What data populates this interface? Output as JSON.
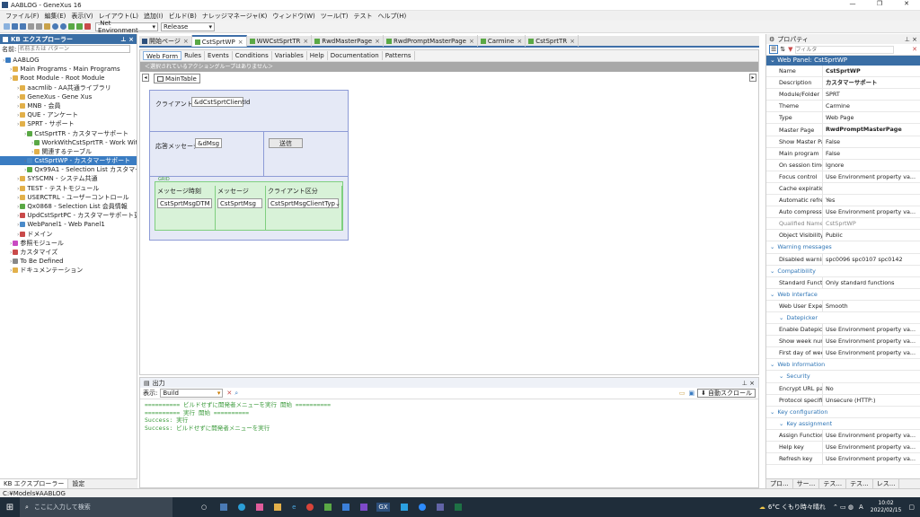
{
  "window": {
    "title": "AABLOG - GeneXus 16"
  },
  "menu": [
    "ファイル(F)",
    "編集(E)",
    "表示(V)",
    "レイアウト(L)",
    "追加(I)",
    "ビルド(B)",
    "ナレッジマネージャ(K)",
    "ウィンドウ(W)",
    "ツール(T)",
    "テスト",
    "ヘルプ(H)"
  ],
  "toolbar": {
    "environment": ".Net Environment",
    "configuration": "Release"
  },
  "explorer": {
    "title": "KB エクスプローラー",
    "filter_label": "名前:",
    "filter_placeholder": "名前または パターン",
    "items": [
      {
        "label": "AABLOG",
        "indent": 0,
        "color": "#3a7cc2"
      },
      {
        "label": "Main Programs - Main Programs",
        "indent": 1,
        "color": "#e2b04a"
      },
      {
        "label": "Root Module - Root Module",
        "indent": 1,
        "color": "#e2b04a"
      },
      {
        "label": "aacmlib - AA共通ライブラリ",
        "indent": 2,
        "color": "#e2b04a"
      },
      {
        "label": "GeneXus - Gene Xus",
        "indent": 2,
        "color": "#e2b04a"
      },
      {
        "label": "MNB - 会員",
        "indent": 2,
        "color": "#e2b04a"
      },
      {
        "label": "QUE - アンケート",
        "indent": 2,
        "color": "#e2b04a"
      },
      {
        "label": "SPRT - サポート",
        "indent": 2,
        "color": "#e2b04a"
      },
      {
        "label": "CstSprtTR - カスタマーサポート",
        "indent": 3,
        "color": "#5aa845"
      },
      {
        "label": "WorkWithCstSprtTR - Work With",
        "indent": 4,
        "color": "#5aa845"
      },
      {
        "label": "関連するテーブル",
        "indent": 4,
        "color": "#e2b04a"
      },
      {
        "label": "CstSprtWP - カスタマーサポート",
        "indent": 3,
        "color": "#4a8ac9",
        "selected": true
      },
      {
        "label": "Qx99A1 - Selection List カスタマーサ",
        "indent": 3,
        "color": "#5aa845"
      },
      {
        "label": "SYSCMN - システム共通",
        "indent": 2,
        "color": "#e2b04a"
      },
      {
        "label": "TEST - テストモジュール",
        "indent": 2,
        "color": "#e2b04a"
      },
      {
        "label": "USERCTRL - ユーザーコントロール",
        "indent": 2,
        "color": "#e2b04a"
      },
      {
        "label": "Qx0868 - Selection List 会員情報",
        "indent": 2,
        "color": "#5aa845"
      },
      {
        "label": "UpdCstSprtPC - カスタマーサポート更新",
        "indent": 2,
        "color": "#c94a4a"
      },
      {
        "label": "WebPanel1 - Web Panel1",
        "indent": 2,
        "color": "#4a8ac9"
      },
      {
        "label": "ドメイン",
        "indent": 2,
        "color": "#c94a4a"
      },
      {
        "label": "参照モジュール",
        "indent": 1,
        "color": "#c94ac2"
      },
      {
        "label": "カスタマイズ",
        "indent": 1,
        "color": "#c94a4a"
      },
      {
        "label": "To Be Defined",
        "indent": 1,
        "color": "#888888"
      },
      {
        "label": "ドキュメンテーション",
        "indent": 1,
        "color": "#e2b04a"
      }
    ],
    "bottom_tabs": [
      "KB エクスプローラー",
      "設定"
    ]
  },
  "tabs": [
    "開始ページ",
    "CstSprtWP",
    "WWCstSprtTR",
    "RwdMasterPage",
    "RwdPromptMasterPage",
    "Carmine",
    "CstSprtTR"
  ],
  "subtabs": [
    "Web Form",
    "Rules",
    "Events",
    "Conditions",
    "Variables",
    "Help",
    "Documentation",
    "Patterns"
  ],
  "action_group_hint": "＜選択されているアクショングループはありません＞",
  "form": {
    "maintable": "MainTable",
    "client_label": "クライアントId",
    "client_value": "&dCstSprtClientId",
    "reply_label": "応答メッセージ",
    "reply_value": "&dMsg",
    "send_button": "送信",
    "grid_label": "GRID",
    "grid_headers": [
      "メッセージ時刻",
      "メッセージ",
      "クライアント区分"
    ],
    "grid_cells": [
      "CstSprtMsgDTM",
      "CstSprtMsg",
      "CstSprtMsgClientTyp"
    ]
  },
  "output": {
    "title": "出力",
    "show_label": "表示:",
    "show_value": "Build",
    "autoscroll": "自動スクロール",
    "lines": [
      "========== ビルドせずに開発者メニューを実行 開始 ==========",
      "========== 実行 開始 ==========",
      "Success: 実行",
      "Success: ビルドせずに開発者メニューを実行"
    ]
  },
  "properties": {
    "title": "プロパティ",
    "filter_placeholder": "フィルタ",
    "object_title": "Web Panel: CstSprtWP",
    "rows": [
      {
        "n": "Name",
        "v": "CstSprtWP",
        "bold": true
      },
      {
        "n": "Description",
        "v": "カスタマーサポート",
        "bold": true
      },
      {
        "n": "Module/Folder",
        "v": "SPRT"
      },
      {
        "n": "Theme",
        "v": "Carmine"
      },
      {
        "n": "Type",
        "v": "Web Page"
      },
      {
        "n": "Master Page",
        "v": "RwdPromptMasterPage",
        "bold": true
      },
      {
        "n": "Show Master Page w",
        "v": "False"
      },
      {
        "n": "Main program",
        "v": "False"
      },
      {
        "n": "On session timeout",
        "v": "Ignore"
      },
      {
        "n": "Focus control",
        "v": "Use Environment property va..."
      },
      {
        "n": "Cache expiration lap",
        "v": ""
      },
      {
        "n": "Automatic refresh",
        "v": "Yes"
      },
      {
        "n": "Auto compress http",
        "v": "Use Environment property va..."
      },
      {
        "n": "Qualified Name",
        "v": "CstSprtWP",
        "gray": true
      },
      {
        "n": "Object Visibility",
        "v": "Public"
      },
      {
        "sec": "Warning messages"
      },
      {
        "n": "Disabled warnings",
        "v": "spc0096 spc0107 spc0142"
      },
      {
        "sec": "Compatibility"
      },
      {
        "n": "Standard Function",
        "v": "Only standard functions"
      },
      {
        "sec": "Web interface"
      },
      {
        "n": "Web User Experien",
        "v": "Smooth"
      },
      {
        "sec": "Datepicker",
        "sub": true
      },
      {
        "n": "Enable Datepick",
        "v": "Use Environment property va..."
      },
      {
        "n": "Show week nun",
        "v": "Use Environment property va..."
      },
      {
        "n": "First day of wee",
        "v": "Use Environment property va..."
      },
      {
        "sec": "Web information"
      },
      {
        "sec": "Security",
        "sub": true
      },
      {
        "n": "Encrypt URL pa",
        "v": "No"
      },
      {
        "n": "Protocol specifi",
        "v": "Unsecure (HTTP:)"
      },
      {
        "sec": "Key configuration"
      },
      {
        "sec": "Key assignment",
        "sub": true
      },
      {
        "n": "Assign Function",
        "v": "Use Environment property va..."
      },
      {
        "n": "Help key",
        "v": "Use Environment property va..."
      },
      {
        "n": "Refresh key",
        "v": "Use Environment property va..."
      }
    ],
    "bottom_tabs": [
      "プロ...",
      "サー...",
      "テス...",
      "テス...",
      "レス..."
    ]
  },
  "status": {
    "path": "C:¥Models¥AABLOG"
  },
  "taskbar": {
    "search": "ここに入力して検索",
    "weather": "6°C くもり時々晴れ",
    "ime": "A",
    "time": "10:02",
    "date": "2022/02/15"
  }
}
